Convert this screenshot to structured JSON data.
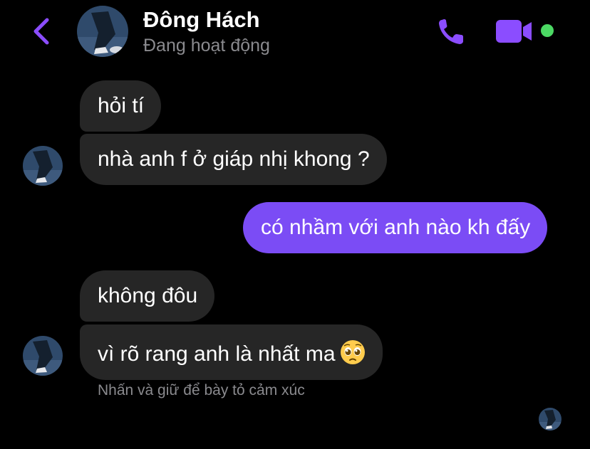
{
  "header": {
    "contact_name": "Đông Hách",
    "status": "Đang hoạt động"
  },
  "messages": [
    {
      "direction": "incoming",
      "text": "hỏi tí"
    },
    {
      "direction": "incoming",
      "text": "nhà anh f ở giáp nhị khong ?"
    },
    {
      "direction": "outgoing",
      "text": "có nhầm với anh nào kh đấy"
    },
    {
      "direction": "incoming",
      "text": "không đôu"
    },
    {
      "direction": "incoming",
      "text": "vì rõ rang anh là nhất ma",
      "emoji": "pleading-face"
    }
  ],
  "reaction_hint": "Nhấn và giữ để bày tỏ cảm xúc",
  "icons": {
    "back": "chevron-left-icon",
    "call": "phone-icon",
    "video": "video-camera-icon",
    "presence": "active-status-dot"
  },
  "colors": {
    "accent": "#7b4cf5",
    "incoming_bubble": "#262626",
    "active": "#4cd964",
    "secondary_text": "#8a8a8e"
  }
}
